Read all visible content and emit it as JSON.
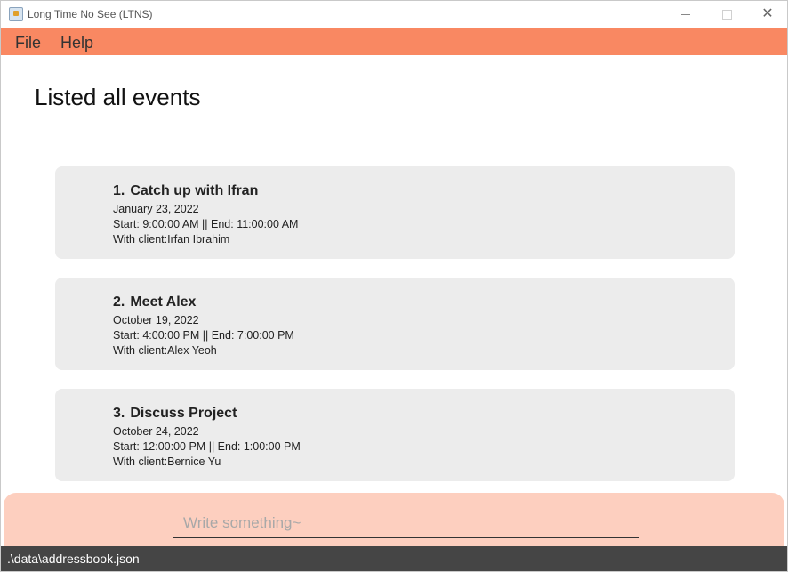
{
  "window": {
    "title": "Long Time No See (LTNS)"
  },
  "menu": {
    "items": [
      "File",
      "Help"
    ]
  },
  "result": {
    "text": "Listed all events"
  },
  "events": [
    {
      "index": "1.",
      "title": "Catch up with Ifran",
      "date": "January 23, 2022",
      "time": "Start: 9:00:00 AM || End: 11:00:00 AM",
      "client": "With client:Irfan Ibrahim"
    },
    {
      "index": "2.",
      "title": "Meet Alex",
      "date": "October 19, 2022",
      "time": "Start: 4:00:00 PM || End: 7:00:00 PM",
      "client": "With client:Alex Yeoh"
    },
    {
      "index": "3.",
      "title": "Discuss Project",
      "date": "October 24, 2022",
      "time": "Start: 12:00:00 PM || End: 1:00:00 PM",
      "client": "With client:Bernice Yu"
    }
  ],
  "command": {
    "placeholder": "Write something~",
    "value": ""
  },
  "status": {
    "path": ".\\data\\addressbook.json"
  },
  "colors": {
    "menu_bar": "#f98862",
    "command_box": "#fdcfbf",
    "card": "#ececec",
    "status_bar": "#454545"
  },
  "icons": {
    "app": "app-icon",
    "minimize": "minimize-icon",
    "maximize": "maximize-icon",
    "close": "close-icon"
  }
}
